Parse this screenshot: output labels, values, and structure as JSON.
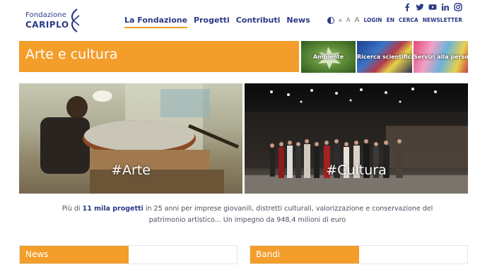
{
  "header": {
    "logo_line1": "Fondazione",
    "logo_line2": "CARIPLO",
    "nav": [
      {
        "label": "La Fondazione",
        "active": true
      },
      {
        "label": "Progetti",
        "active": false
      },
      {
        "label": "Contributi",
        "active": false
      },
      {
        "label": "News",
        "active": false
      }
    ],
    "social_icons": [
      "facebook-icon",
      "twitter-icon",
      "youtube-icon",
      "linkedin-icon",
      "instagram-icon"
    ],
    "utility": {
      "font_small": "A",
      "font_medium": "A",
      "font_large": "A",
      "login": "LOGIN",
      "language": "EN",
      "search": "CERCA",
      "newsletter": "NEWSLETTER"
    }
  },
  "banner": {
    "title": "Arte e cultura"
  },
  "thumbnails": [
    {
      "label": "Ambiente"
    },
    {
      "label": "Ricerca scientifica"
    },
    {
      "label": "Servizi alla persona"
    }
  ],
  "heroes": [
    {
      "tag": "#Arte"
    },
    {
      "tag": "#Cultura"
    }
  ],
  "intro": {
    "prefix": "Più di ",
    "highlight": "11 mila progetti",
    "line1_rest": " in 25 anni per imprese giovanili, distretti culturali, valorizzazione e conservazione del",
    "line2": "patrimonio artistico... Un impegno da 948,4 milioni di euro"
  },
  "sections": {
    "news": "News",
    "bandi": "Bandi"
  },
  "colors": {
    "accent": "#f39d2a",
    "brand": "#2b3a86"
  }
}
